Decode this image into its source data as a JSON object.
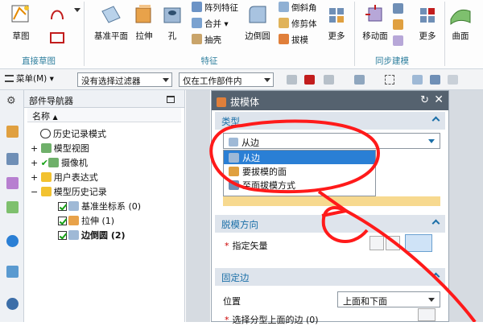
{
  "ribbon": {
    "sketch_label": "草图",
    "datum_plane_label": "基准平面",
    "extrude_label": "拉伸",
    "hole_label": "孔",
    "pattern_feature_label": "阵列特征",
    "unite_label": "合并",
    "shell_label": "抽壳",
    "edge_blend_label": "边倒圆",
    "chamfer_label": "倒斜角",
    "trim_body_label": "修剪体",
    "draft_label": "拔模",
    "more_label_1": "更多",
    "move_face_label": "移动面",
    "more_label_2": "更多",
    "surface_label": "曲面",
    "group_direct_sketch": "直接草图",
    "group_feature": "特征",
    "group_sync_modeling": "同步建模"
  },
  "toolbar": {
    "menu_label": "菜单(M)",
    "filter_value": "没有选择过滤器",
    "scope_value": "仅在工作部件内"
  },
  "navigator": {
    "title": "部件导航器",
    "column_name": "名称",
    "tree": [
      {
        "label": "历史记录模式"
      },
      {
        "label": "模型视图"
      },
      {
        "label": "摄像机"
      },
      {
        "label": "用户表达式"
      },
      {
        "label": "模型历史记录"
      },
      {
        "label": "基准坐标系 (0)"
      },
      {
        "label": "拉伸 (1)"
      },
      {
        "label": "边倒圆 (2)"
      }
    ]
  },
  "dialog": {
    "title": "拔模体",
    "section_type": "类型",
    "type_value": "从边",
    "type_options": [
      "从边",
      "要拔模的面",
      "至面拔模方式"
    ],
    "section_draft_direction": "脱模方向",
    "specify_vector_label": "指定矢量",
    "section_fixed_edge": "固定边",
    "position_label": "位置",
    "position_value": "上面和下面",
    "select_edge_label": "选择分型上面的边 (0)"
  },
  "annotation": {
    "color": "#ff1a1a"
  }
}
